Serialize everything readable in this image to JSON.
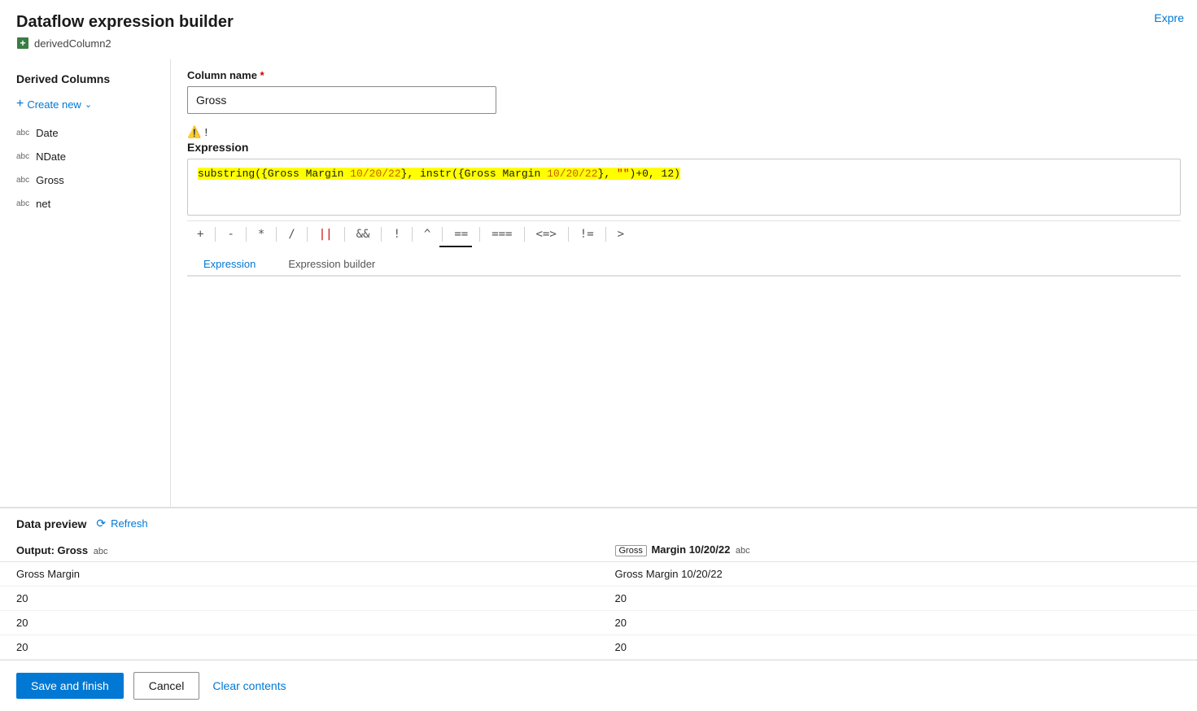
{
  "page": {
    "title": "Dataflow expression builder",
    "top_right_link": "Expre",
    "subtitle": "derivedColumn2"
  },
  "left_panel": {
    "section_title": "Derived Columns",
    "create_new_label": "Create new",
    "columns": [
      {
        "type": "abc",
        "name": "Date"
      },
      {
        "type": "abc",
        "name": "NDate"
      },
      {
        "type": "abc",
        "name": "Gross"
      },
      {
        "type": "abc",
        "name": "net"
      }
    ]
  },
  "right_panel": {
    "column_name_label": "Column name",
    "required_indicator": "*",
    "column_name_value": "Gross",
    "warning_text": "!",
    "expression_label": "Expression",
    "expression_text": "substring({Gross Margin 10/20/22}, instr({Gross Margin 10/20/22}, \"\")+0, 12)",
    "operators": [
      "+",
      "-",
      "*",
      "/",
      "||",
      "&&",
      "!",
      "^",
      "==",
      "===",
      "<=>",
      "!=",
      ">"
    ]
  },
  "data_preview": {
    "section_title": "Data preview",
    "refresh_label": "Refresh",
    "table": {
      "columns": [
        {
          "label": "Output: Gross",
          "type": "abc"
        },
        {
          "label": "Gross Margin 10/20/22",
          "type": "abc",
          "badge": "Gross"
        }
      ],
      "rows": [
        [
          "Gross Margin",
          "Gross Margin 10/20/22"
        ],
        [
          "20",
          "20"
        ],
        [
          "20",
          "20"
        ],
        [
          "20",
          "20"
        ]
      ]
    }
  },
  "bottom_bar": {
    "save_finish_label": "Save and finish",
    "cancel_label": "Cancel",
    "clear_contents_label": "Clear contents"
  },
  "tabs": [
    {
      "label": "Expression",
      "active": true
    },
    {
      "label": "Expression builder",
      "active": false
    }
  ]
}
